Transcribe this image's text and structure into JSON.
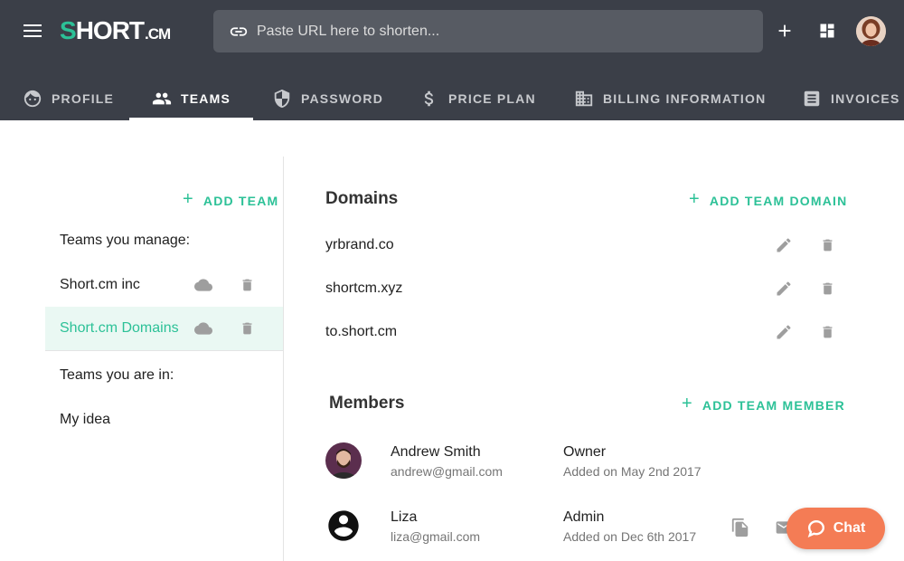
{
  "app": {
    "logo_text_s": "S",
    "logo_text_rest": "HORT",
    "logo_text_suffix": ".CM"
  },
  "search": {
    "placeholder": "Paste URL here to shorten..."
  },
  "tabs": [
    {
      "label": "PROFILE",
      "icon": "face-icon",
      "active": false
    },
    {
      "label": "TEAMS",
      "icon": "people-icon",
      "active": true
    },
    {
      "label": "PASSWORD",
      "icon": "shield-icon",
      "active": false
    },
    {
      "label": "PRICE PLAN",
      "icon": "dollar-icon",
      "active": false
    },
    {
      "label": "BILLING INFORMATION",
      "icon": "building-icon",
      "active": false
    },
    {
      "label": "INVOICES",
      "icon": "receipt-icon",
      "active": false
    }
  ],
  "teams_panel": {
    "add_team_label": "ADD TEAM",
    "manage_label": "Teams you manage:",
    "managed_teams": [
      {
        "name": "Short.cm inc",
        "selected": false
      },
      {
        "name": "Short.cm Domains",
        "selected": true
      }
    ],
    "member_label": "Teams you are in:",
    "member_teams": [
      {
        "name": "My idea"
      }
    ]
  },
  "domains": {
    "title": "Domains",
    "add_label": "ADD TEAM DOMAIN",
    "items": [
      {
        "name": "yrbrand.co"
      },
      {
        "name": "shortcm.xyz"
      },
      {
        "name": "to.short.cm"
      }
    ]
  },
  "members": {
    "title": "Members",
    "add_label": "ADD TEAM MEMBER",
    "items": [
      {
        "name": "Andrew Smith",
        "email": "andrew@gmail.com",
        "role": "Owner",
        "added": "Added on May 2nd 2017"
      },
      {
        "name": "Liza",
        "email": "liza@gmail.com",
        "role": "Admin",
        "added": "Added on Dec 6th 2017"
      }
    ]
  },
  "chat": {
    "label": "Chat"
  },
  "colors": {
    "topbar": "#3b3f48",
    "accent": "#2cc197",
    "chat": "#f47c55"
  }
}
